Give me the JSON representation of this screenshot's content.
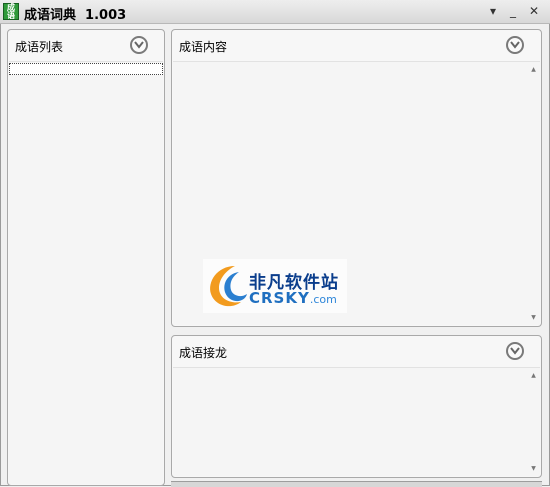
{
  "window": {
    "title": "成语词典  1.003",
    "icon_label": "成语",
    "controls": {
      "menu": "▾",
      "minimize": "_",
      "close": "✕"
    }
  },
  "panels": {
    "list": {
      "title": "成语列表",
      "selected_item": ""
    },
    "content": {
      "title": "成语内容"
    },
    "chain": {
      "title": "成语接龙"
    }
  },
  "watermark": {
    "name": "非凡软件站",
    "domain": "CRSKY",
    "domain_suffix": ".com"
  },
  "colors": {
    "watermark_dark": "#0a3d8c",
    "watermark_light": "#1f6fc0",
    "logo_orange": "#f29b1e",
    "logo_blue": "#2b7fd0"
  }
}
